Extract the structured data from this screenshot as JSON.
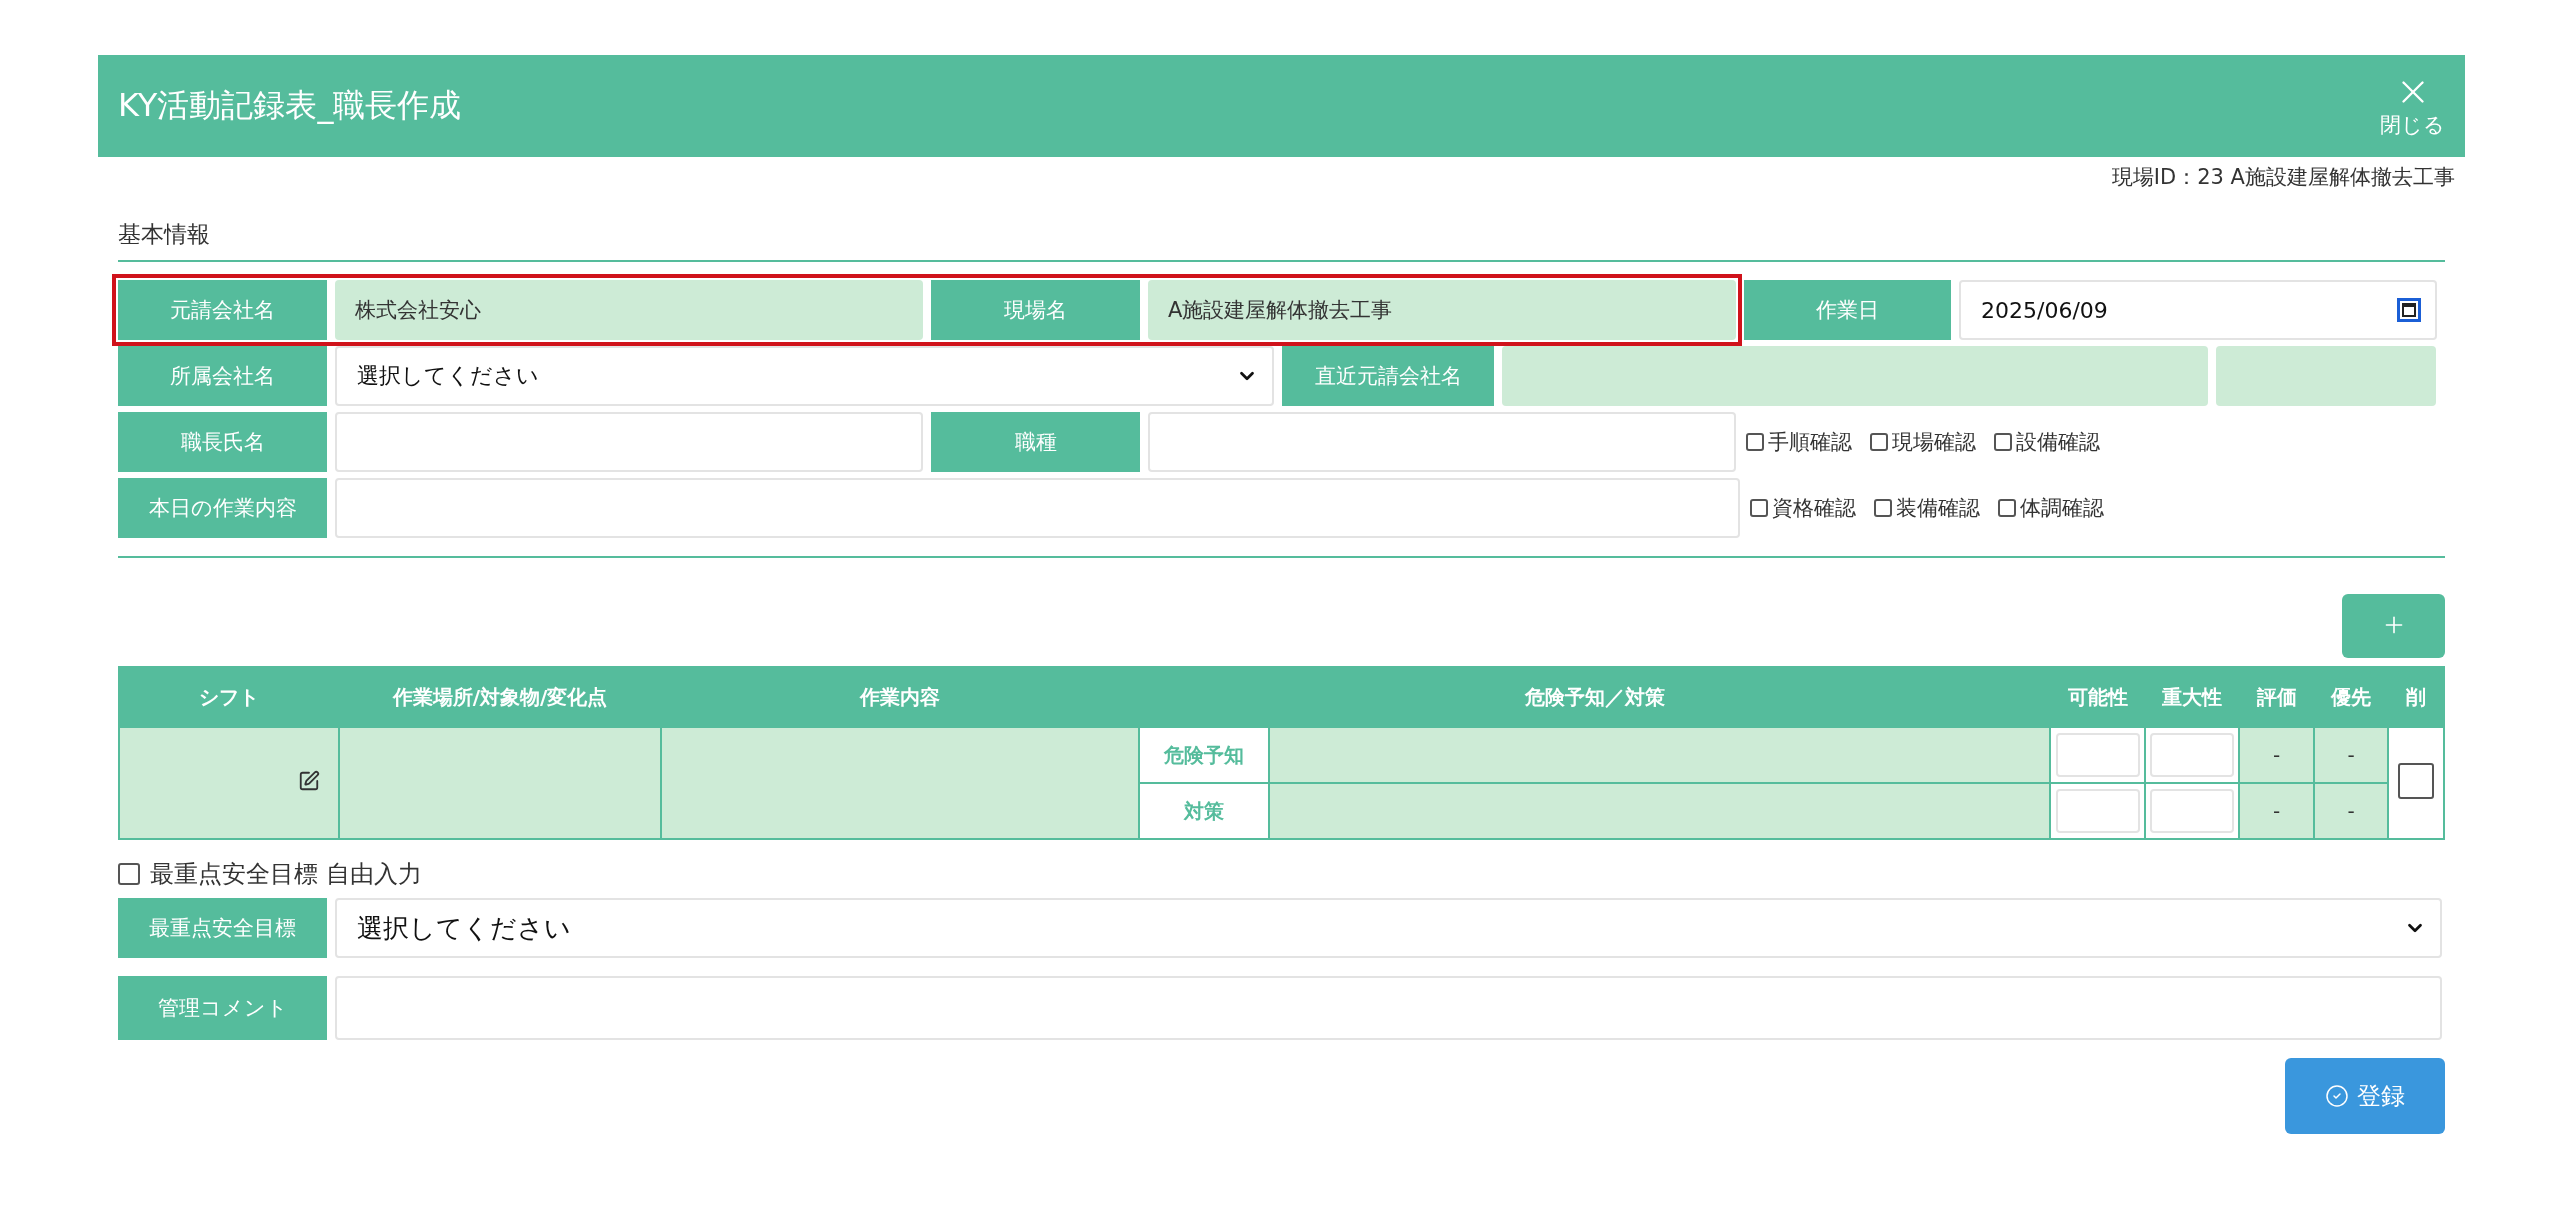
{
  "header": {
    "title": "KY活動記録表_職長作成",
    "close_label": "閉じる"
  },
  "site_id": "現場ID：23 A施設建屋解体撤去工事",
  "section_title": "基本情報",
  "basic_info": {
    "prime_contractor": {
      "label": "元請会社名",
      "value": "株式会社安心"
    },
    "site_name": {
      "label": "現場名",
      "value": "A施設建屋解体撤去工事"
    },
    "work_date": {
      "label": "作業日",
      "value": "2025/06/09"
    },
    "affiliated_company": {
      "label": "所属会社名",
      "value": "選択してください"
    },
    "nearest_prime": {
      "label": "直近元請会社名"
    },
    "foreman_name": {
      "label": "職長氏名"
    },
    "trade": {
      "label": "職種"
    },
    "today_work": {
      "label": "本日の作業内容"
    }
  },
  "check_rows": [
    [
      {
        "label": "手順確認",
        "checked": false
      },
      {
        "label": "現場確認",
        "checked": false
      },
      {
        "label": "設備確認",
        "checked": false
      }
    ],
    [
      {
        "label": "資格確認",
        "checked": false
      },
      {
        "label": "装備確認",
        "checked": false
      },
      {
        "label": "体調確認",
        "checked": false
      }
    ]
  ],
  "table": {
    "columns": [
      "シフト",
      "作業場所/対象物/変化点",
      "作業内容",
      "危険予知／対策",
      "可能性",
      "重大性",
      "評価",
      "優先",
      "削"
    ],
    "rows": [
      {
        "sub_rows": [
          {
            "label": "危険予知",
            "evaluation": "-",
            "priority": "-"
          },
          {
            "label": "対策",
            "evaluation": "-",
            "priority": "-"
          }
        ],
        "delete_checked": false
      }
    ]
  },
  "free_input": {
    "label": "最重点安全目標 自由入力",
    "checked": false
  },
  "top_goal": {
    "label": "最重点安全目標",
    "value": "選択してください"
  },
  "comment": {
    "label": "管理コメント"
  },
  "register_button": "登録"
}
